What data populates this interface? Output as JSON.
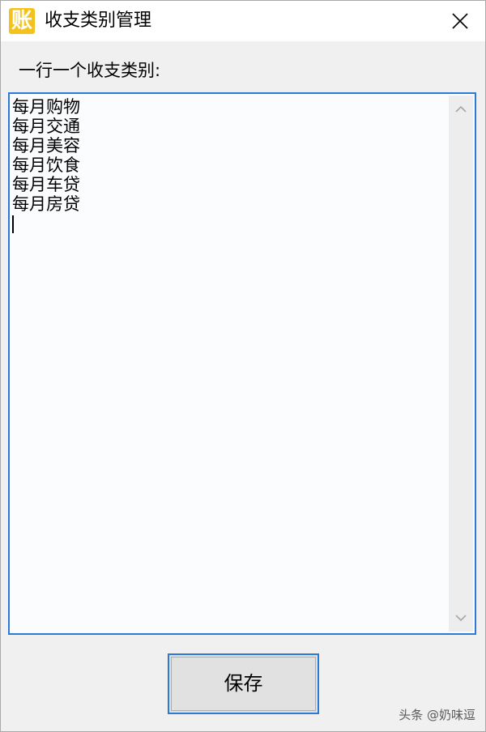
{
  "window": {
    "title": "收支类别管理",
    "app_icon_glyph": "账",
    "accent": "#2a7ad6",
    "icon_color": "#f4c21c"
  },
  "prompt_label": "一行一个收支类别:",
  "category_lines": [
    "每月购物",
    "每月交通",
    "每月美容",
    "每月饮食",
    "每月车贷",
    "每月房贷"
  ],
  "save_button_label": "保存",
  "watermark_text": "头条 @奶味逗",
  "icons": {
    "close": "close-icon",
    "scroll_up": "chevron-up-icon",
    "scroll_down": "chevron-down-icon"
  }
}
